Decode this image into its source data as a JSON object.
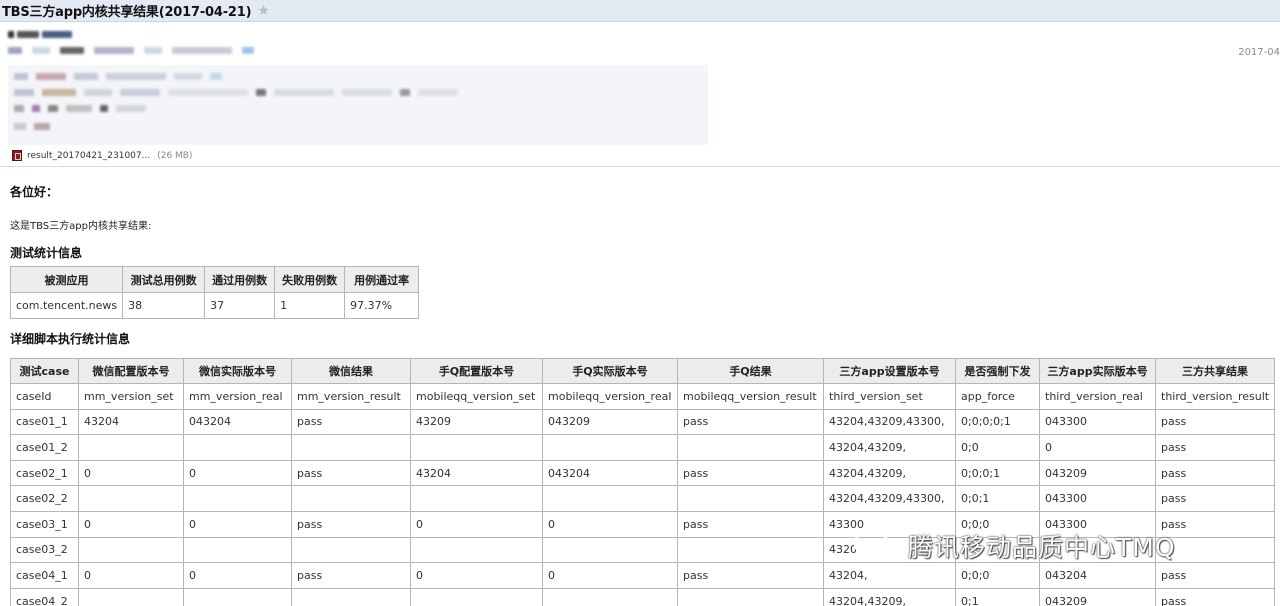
{
  "subject": {
    "title": "TBS三方app内核共享结果(2017-04-21)"
  },
  "header": {
    "date": "2017-04"
  },
  "attachment": {
    "name": "result_20170421_231007...",
    "size": "(26 MB)"
  },
  "body": {
    "greeting": "各位好：",
    "intro": "这是TBS三方app内核共享结果:",
    "stats_heading": "测试统计信息",
    "details_heading": "详细脚本执行统计信息"
  },
  "stats_table": {
    "headers": [
      "被测应用",
      "测试总用例数",
      "通过用例数",
      "失败用例数",
      "用例通过率"
    ],
    "row": [
      "com.tencent.news",
      "38",
      "37",
      "1",
      "97.37%"
    ]
  },
  "detail_table": {
    "headers": [
      "测试case",
      "微信配置版本号",
      "微信实际版本号",
      "微信结果",
      "手Q配置版本号",
      "手Q实际版本号",
      "手Q结果",
      "三方app设置版本号",
      "是否强制下发",
      "三方app实际版本号",
      "三方共享结果"
    ],
    "rows": [
      [
        "caseId",
        "mm_version_set",
        "mm_version_real",
        "mm_version_result",
        "mobileqq_version_set",
        "mobileqq_version_real",
        "mobileqq_version_result",
        "third_version_set",
        "app_force",
        "third_version_real",
        "third_version_result"
      ],
      [
        "case01_1",
        "43204",
        "043204",
        "pass",
        "43209",
        "043209",
        "pass",
        "43204,43209,43300,",
        "0;0;0;0;1",
        "043300",
        "pass"
      ],
      [
        "case01_2",
        "",
        "",
        "",
        "",
        "",
        "",
        "43204,43209,",
        "0;0",
        "0",
        "pass"
      ],
      [
        "case02_1",
        "0",
        "0",
        "pass",
        "43204",
        "043204",
        "pass",
        "43204,43209,",
        "0;0;0;1",
        "043209",
        "pass"
      ],
      [
        "case02_2",
        "",
        "",
        "",
        "",
        "",
        "",
        "43204,43209,43300,",
        "0;0;1",
        "043300",
        "pass"
      ],
      [
        "case03_1",
        "0",
        "0",
        "pass",
        "0",
        "0",
        "pass",
        "43300",
        "0;0;0",
        "043300",
        "pass"
      ],
      [
        "case03_2",
        "",
        "",
        "",
        "",
        "",
        "",
        "4320",
        "",
        "",
        ""
      ],
      [
        "case04_1",
        "0",
        "0",
        "pass",
        "0",
        "0",
        "pass",
        "43204,",
        "0;0;0",
        "043204",
        "pass"
      ],
      [
        "case04_2",
        "",
        "",
        "",
        "",
        "",
        "",
        "43204,43209,",
        "0;1",
        "043209",
        "pass"
      ]
    ]
  },
  "watermark": {
    "text": "腾讯移动品质中心TMQ",
    "icon": "wechat-icon"
  },
  "colors": {
    "subject_bar": "#e4eaf4",
    "table_header": "#ececec",
    "border": "#b5b5b5"
  }
}
